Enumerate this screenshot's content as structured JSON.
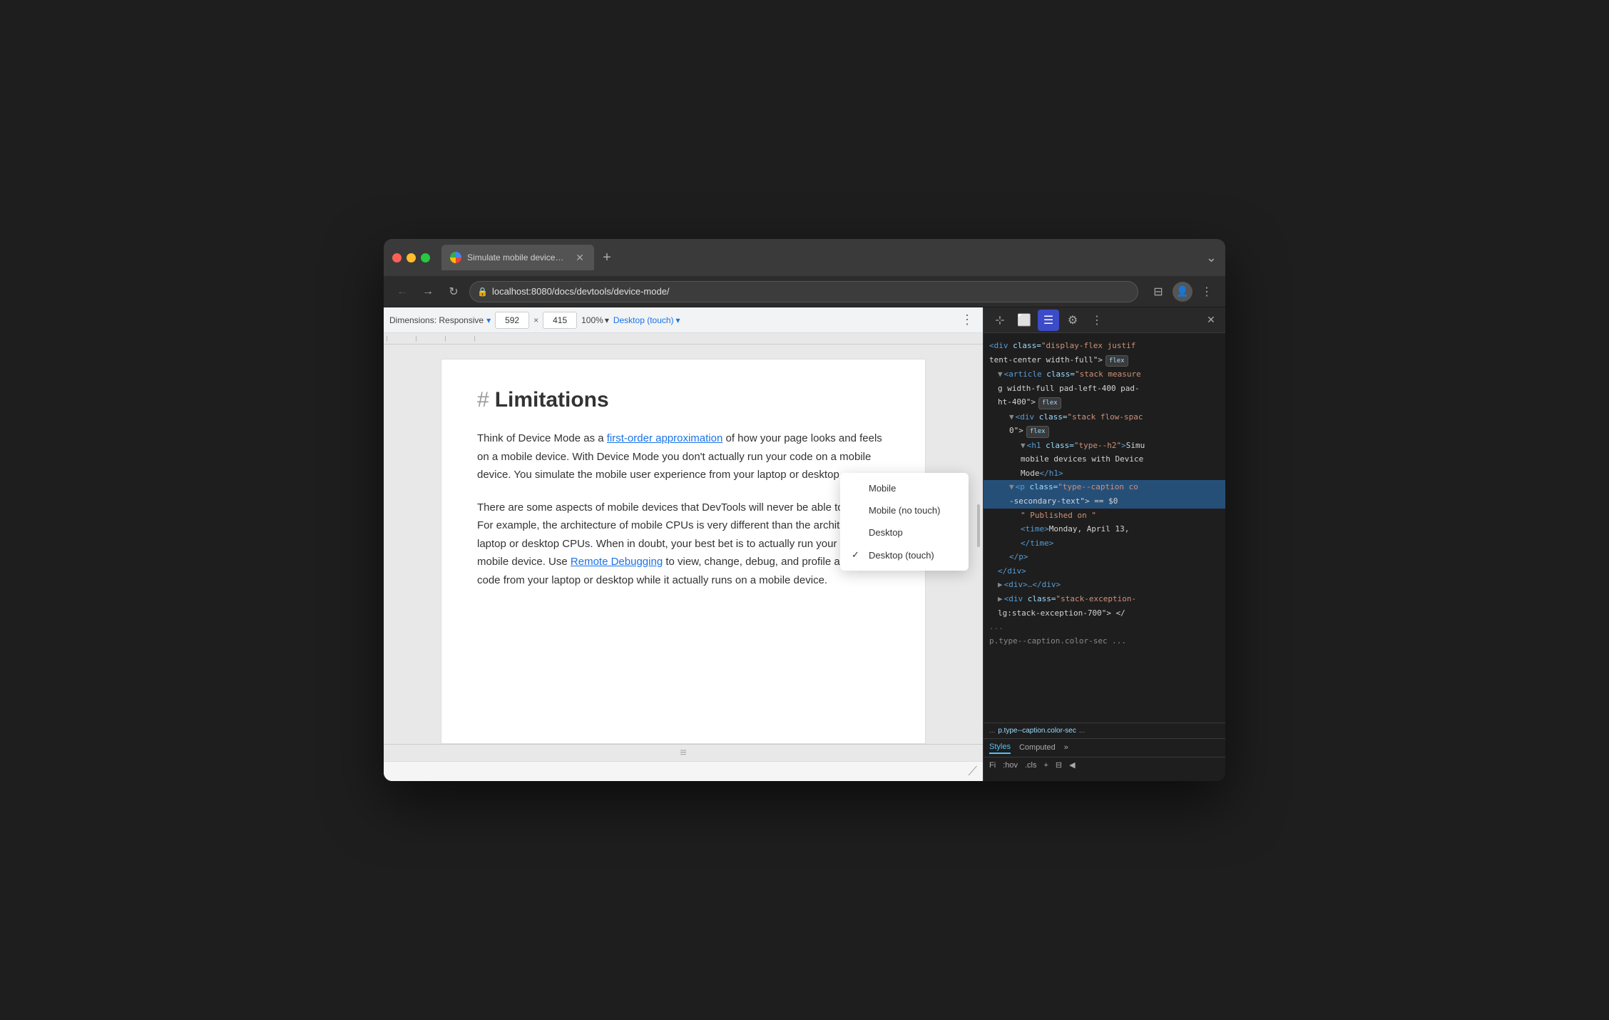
{
  "window": {
    "title": "Simulate mobile devices with D",
    "tab_title": "Simulate mobile devices with D"
  },
  "browser": {
    "back_label": "←",
    "forward_label": "→",
    "reload_label": "↻",
    "url": "localhost:8080/docs/devtools/device-mode/",
    "new_tab_label": "+",
    "window_controls_label": "⌄"
  },
  "traffic_lights": {
    "close": "●",
    "minimize": "●",
    "maximize": "●"
  },
  "devtools_bar": {
    "dimensions_label": "Dimensions: Responsive",
    "width_value": "592",
    "height_value": "415",
    "zoom_label": "100%",
    "device_label": "Desktop (touch)",
    "more_label": "⋮"
  },
  "page": {
    "heading_hash": "#",
    "heading": "Limitations",
    "paragraph1_start": "Think of Device Mode as a ",
    "paragraph1_link": "first-order approximation",
    "paragraph1_end": " of how your page looks and feels on a mobile device. With Device Mode you don't actually run your code on a mobile device. You simulate the mobile user experience from your laptop or desktop.",
    "paragraph2_start": "There are some aspects of mobile devices that DevTools will never be able to simulate. For example, the architecture of mobile CPUs is very different than the architecture of laptop or desktop CPUs. When in doubt, your best bet is to actually run your page on a mobile device. Use ",
    "paragraph2_link": "Remote Debugging",
    "paragraph2_end": " to view, change, debug, and profile a page's code from your laptop or desktop while it actually runs on a mobile device."
  },
  "dropdown": {
    "items": [
      {
        "label": "Mobile",
        "checked": false
      },
      {
        "label": "Mobile (no touch)",
        "checked": false
      },
      {
        "label": "Desktop",
        "checked": false
      },
      {
        "label": "Desktop (touch)",
        "checked": true
      }
    ]
  },
  "devtools": {
    "tabs": {
      "cursor": "⊹",
      "elements": "⬜",
      "console": "☰",
      "gear": "⚙",
      "more": "⋮",
      "close": "✕"
    },
    "html_lines": [
      {
        "indent": 0,
        "content": "<div class=\"display-flex justif",
        "type": "tag-open"
      },
      {
        "indent": 0,
        "content": "tent-center width-full\">",
        "badge": "flex",
        "type": "text"
      },
      {
        "indent": 1,
        "content": "<article class=\"stack measure",
        "type": "tag-open"
      },
      {
        "indent": 1,
        "content": "g width-full pad-left-400 pad-",
        "type": "text"
      },
      {
        "indent": 1,
        "content": "ht-400\">",
        "badge": "flex",
        "type": "text"
      },
      {
        "indent": 2,
        "content": "<div class=\"stack flow-spac",
        "type": "tag-open"
      },
      {
        "indent": 2,
        "content": "0\">",
        "badge": "flex",
        "type": "text"
      },
      {
        "indent": 3,
        "content": "<h1 class=\"type--h2\">Simu",
        "type": "tag-open"
      },
      {
        "indent": 3,
        "content": "mobile devices with Device",
        "type": "text"
      },
      {
        "indent": 3,
        "content": "Mode</h1>",
        "type": "tag-close"
      },
      {
        "indent": 2,
        "content": "<p class=\"type--caption co",
        "type": "tag-open",
        "selected": true
      },
      {
        "indent": 2,
        "content": "-secondary-text\"> == $0",
        "type": "text",
        "selected": true
      },
      {
        "indent": 3,
        "content": "\" Published on \"",
        "type": "text"
      },
      {
        "indent": 3,
        "content": "<time>Monday, April 13,",
        "type": "tag"
      },
      {
        "indent": 3,
        "content": "</time>",
        "type": "tag-close"
      },
      {
        "indent": 2,
        "content": "</p>",
        "type": "tag-close"
      },
      {
        "indent": 1,
        "content": "</div>",
        "type": "tag-close"
      },
      {
        "indent": 1,
        "content": "▶<div>…</div>",
        "type": "collapsed"
      },
      {
        "indent": 1,
        "content": "▶<div class=\"stack-exception-",
        "type": "collapsed"
      },
      {
        "indent": 1,
        "content": "lg:stack-exception-700\"> </",
        "type": "text"
      },
      {
        "indent": 0,
        "content": "...",
        "type": "ellipsis"
      },
      {
        "indent": 0,
        "content": "p.type--caption.color-sec ...",
        "type": "breadcrumb"
      }
    ]
  },
  "styles": {
    "tabs": [
      "Styles",
      "Computed"
    ],
    "more_tabs": "»",
    "filter_placeholder": "Fi",
    "pseudo_label": ":hov",
    "cls_label": ".cls",
    "add_label": "+",
    "layout_label": "⊟",
    "sidebar_label": "◀"
  }
}
